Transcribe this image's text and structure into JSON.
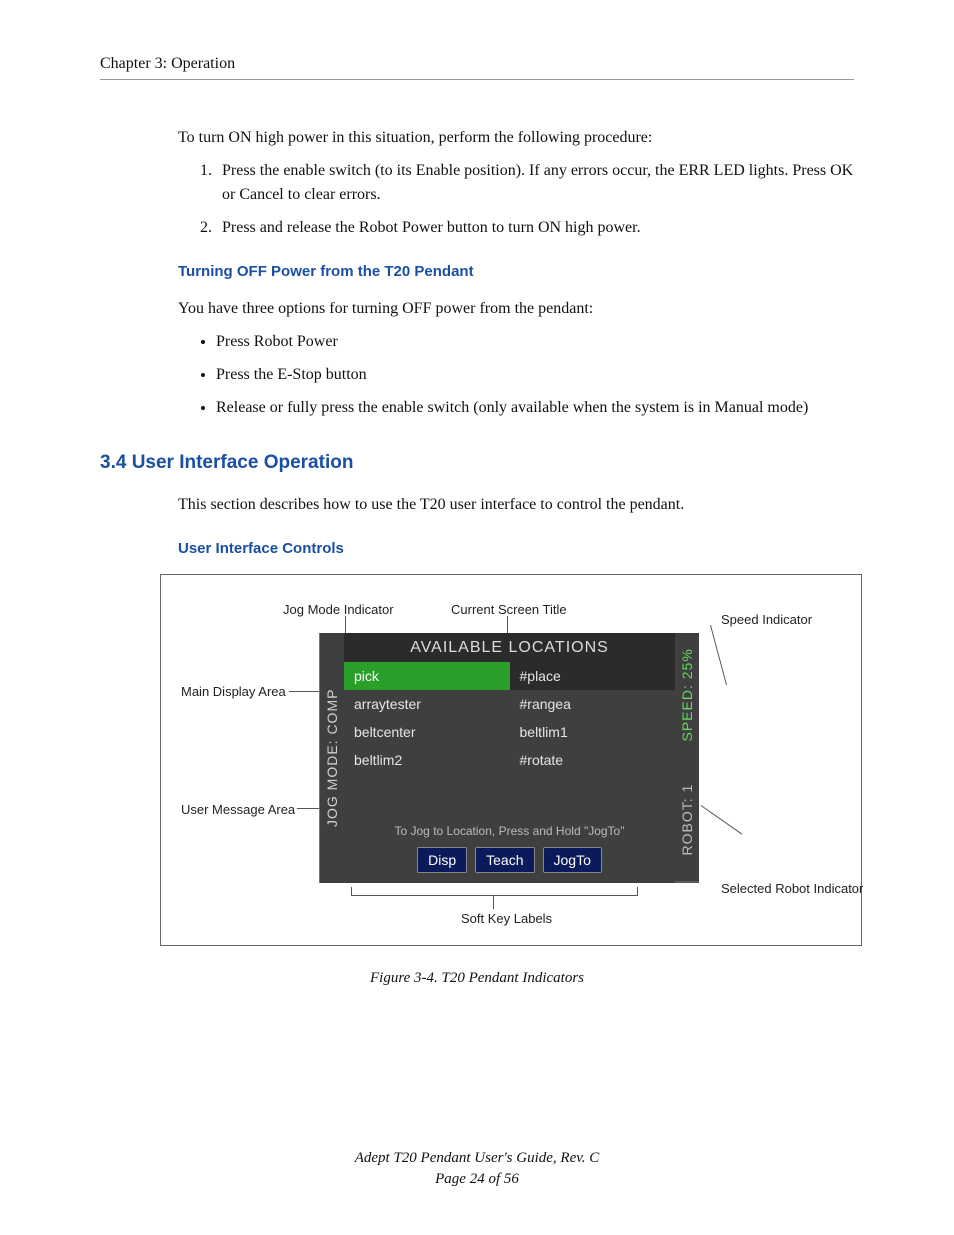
{
  "run_head": "Chapter 3: Operation",
  "intro_p": "To turn ON high power in this situation, perform the following procedure:",
  "proc": [
    "Press the enable switch (to its Enable position). If any errors occur, the ERR LED lights. Press OK or Cancel to clear errors.",
    "Press and release the Robot Power button to turn ON high power."
  ],
  "h3_off": "Turning OFF Power from the T20 Pendant",
  "off_intro": "You have three options for turning OFF power from the pendant:",
  "off_bullets": [
    "Press Robot Power",
    "Press the E-Stop button",
    "Release or fully press the enable switch (only available when the system is in Manual mode)"
  ],
  "h2_ui": "3.4  User Interface Operation",
  "ui_intro": "This section describes how to use the T20 user interface to control the pendant.",
  "h3_controls": "User Interface Controls",
  "figure": {
    "labels": {
      "jog_mode_indicator": "Jog Mode Indicator",
      "current_screen_title": "Current Screen Title",
      "speed_indicator": "Speed Indicator",
      "main_display_area": "Main Display Area",
      "user_message_area": "User Message Area",
      "selected_robot_indicator": "Selected Robot Indicator",
      "soft_key_labels": "Soft Key Labels"
    },
    "pendant": {
      "title": "AVAILABLE LOCATIONS",
      "jog_mode": "JOG MODE: COMP",
      "speed": "SPEED: 25%",
      "robot": "ROBOT: 1",
      "cells": [
        [
          "pick",
          "#place"
        ],
        [
          "arraytester",
          "#rangea"
        ],
        [
          "beltcenter",
          "beltlim1"
        ],
        [
          "beltlim2",
          "#rotate"
        ]
      ],
      "message": "To Jog to Location, Press and Hold \"JogTo\"",
      "softkeys": [
        "Disp",
        "Teach",
        "JogTo"
      ]
    },
    "caption": "Figure 3-4. T20 Pendant Indicators"
  },
  "footer_title": "Adept T20 Pendant User's Guide, Rev. C",
  "footer_page": "Page 24 of 56"
}
